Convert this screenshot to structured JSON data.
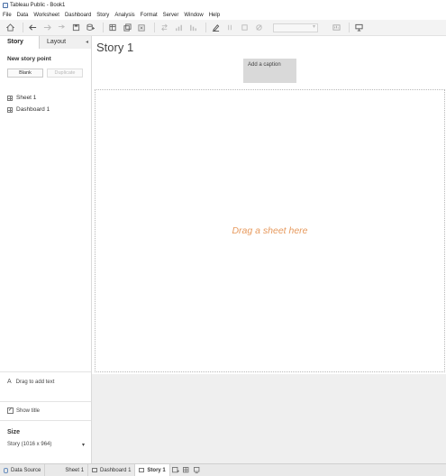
{
  "window": {
    "title": "Tableau Public - Book1"
  },
  "menu": [
    "File",
    "Data",
    "Worksheet",
    "Dashboard",
    "Story",
    "Analysis",
    "Format",
    "Server",
    "Window",
    "Help"
  ],
  "toolbar": {
    "icons": [
      "home-icon",
      "undo-icon",
      "redo-icon",
      "redo-dropdown-icon",
      "save-icon",
      "add-datasource-icon",
      "new-sheet-icon",
      "duplicate-icon",
      "clear-icon",
      "swap-icon",
      "sort-ascending-icon",
      "sort-descending-icon",
      "highlight-icon",
      "group-icon",
      "label-icon",
      "fix-axes-icon",
      "fit-icon",
      "show-me-icon",
      "presentation-icon"
    ]
  },
  "left_pane": {
    "tabs": {
      "story": "Story",
      "layout": "Layout",
      "collapse": "◂"
    },
    "new_story_point": "New story point",
    "buttons": {
      "blank": "Blank",
      "duplicate": "Duplicate"
    },
    "sheets": [
      "Sheet 1",
      "Dashboard 1"
    ],
    "drag_text": "Drag to add text",
    "text_glyph": "A",
    "show_title": {
      "label": "Show title",
      "checked": true,
      "mark": "✓"
    },
    "size": {
      "label": "Size",
      "value": "Story (1016 x 964)",
      "arrow": "▾"
    }
  },
  "story": {
    "title": "Story 1",
    "caption": "Add a caption",
    "placeholder": "Drag a sheet here",
    "placeholder_color": "#e79a5e"
  },
  "bottom_tabs": [
    {
      "label": "Data Source",
      "active": false
    },
    {
      "label": "Sheet 1",
      "active": false
    },
    {
      "label": "Dashboard 1",
      "active": false
    },
    {
      "label": "Story 1",
      "active": true
    }
  ],
  "colors": {
    "caption_bg": "#d9d9d9",
    "toolbar_bg": "#f3f3f3",
    "bottom_bar_bg": "#e9e9e9"
  }
}
